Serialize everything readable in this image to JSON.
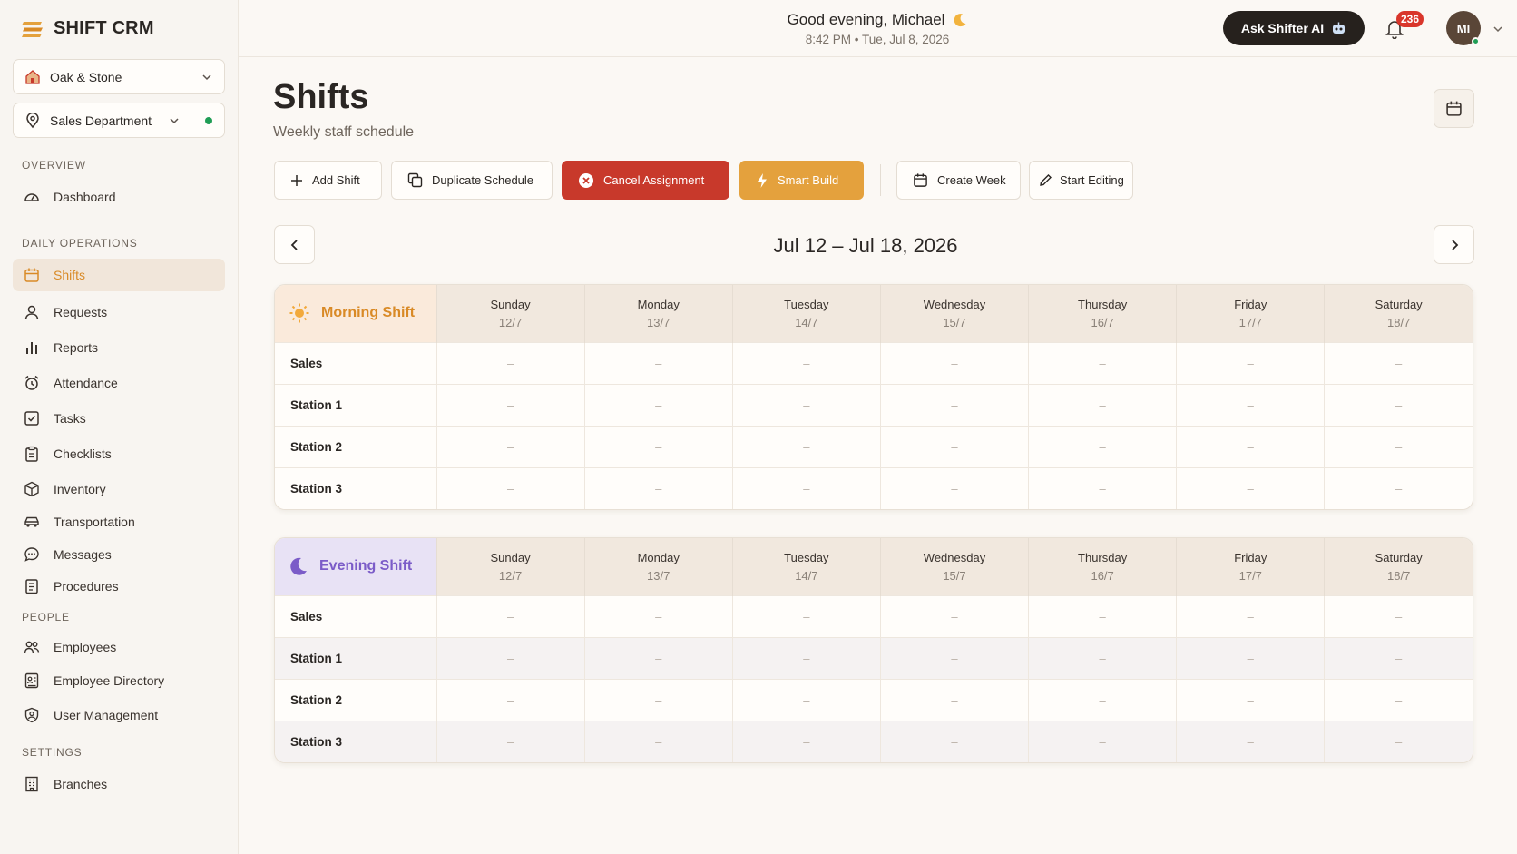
{
  "brand": {
    "name": "SHIFT CRM"
  },
  "sidebar": {
    "business_select": {
      "value": "Oak & Stone"
    },
    "department_select": {
      "value": "Sales Department"
    },
    "sections": {
      "overview": "OVERVIEW",
      "daily": "DAILY OPERATIONS",
      "people": "PEOPLE",
      "settings": "SETTINGS"
    },
    "items": [
      {
        "label": "Dashboard",
        "icon": "dashboard-icon"
      },
      {
        "label": "Shifts",
        "icon": "calendar-icon",
        "active": true
      },
      {
        "label": "Requests",
        "icon": "user-icon"
      },
      {
        "label": "Reports",
        "icon": "bar-chart-icon"
      },
      {
        "label": "Attendance",
        "icon": "alarm-clock-icon"
      },
      {
        "label": "Tasks",
        "icon": "checkbox-icon"
      },
      {
        "label": "Checklists",
        "icon": "clipboard-icon"
      },
      {
        "label": "Inventory",
        "icon": "box-icon"
      },
      {
        "label": "Transportation",
        "icon": "car-icon"
      },
      {
        "label": "Messages",
        "icon": "chat-icon"
      },
      {
        "label": "Procedures",
        "icon": "document-icon"
      },
      {
        "label": "Employees",
        "icon": "users-icon"
      },
      {
        "label": "Employee Directory",
        "icon": "directory-icon"
      },
      {
        "label": "User Management",
        "icon": "user-shield-icon"
      },
      {
        "label": "Branches",
        "icon": "building-icon"
      }
    ]
  },
  "topbar": {
    "greeting": "Good evening, Michael",
    "time": "8:42 PM",
    "date": "Tue, Jul 8, 2026",
    "ask_ai_label": "Ask Shifter AI",
    "notification_count": "236",
    "avatar_initials": "MI"
  },
  "page": {
    "title": "Shifts",
    "subtitle": "Weekly staff schedule"
  },
  "toolbar": {
    "add_shift": "Add Shift",
    "duplicate": "Duplicate Schedule",
    "cancel": "Cancel Assignment",
    "smart_build": "Smart Build",
    "create_week": "Create Week",
    "start_editing": "Start Editing"
  },
  "week": {
    "range": "Jul 12 – Jul 18, 2026"
  },
  "colors": {
    "accent": "#d98a26",
    "danger": "#c8392b",
    "warning": "#e4a13d",
    "evening": "#7b5cc8"
  },
  "days": [
    {
      "name": "Sunday",
      "date": "12/7"
    },
    {
      "name": "Monday",
      "date": "13/7"
    },
    {
      "name": "Tuesday",
      "date": "14/7"
    },
    {
      "name": "Wednesday",
      "date": "15/7"
    },
    {
      "name": "Thursday",
      "date": "16/7"
    },
    {
      "name": "Friday",
      "date": "17/7"
    },
    {
      "name": "Saturday",
      "date": "18/7"
    }
  ],
  "shifts": [
    {
      "title": "Morning Shift",
      "rows": [
        {
          "label": "Sales",
          "cells": [
            "–",
            "–",
            "–",
            "–",
            "–",
            "–",
            "–"
          ]
        },
        {
          "label": "Station 1",
          "cells": [
            "–",
            "–",
            "–",
            "–",
            "–",
            "–",
            "–"
          ]
        },
        {
          "label": "Station 2",
          "cells": [
            "–",
            "–",
            "–",
            "–",
            "–",
            "–",
            "–"
          ]
        },
        {
          "label": "Station 3",
          "cells": [
            "–",
            "–",
            "–",
            "–",
            "–",
            "–",
            "–"
          ]
        }
      ]
    },
    {
      "title": "Evening Shift",
      "rows": [
        {
          "label": "Sales",
          "cells": [
            "–",
            "–",
            "–",
            "–",
            "–",
            "–",
            "–"
          ]
        },
        {
          "label": "Station 1",
          "cells": [
            "–",
            "–",
            "–",
            "–",
            "–",
            "–",
            "–"
          ]
        },
        {
          "label": "Station 2",
          "cells": [
            "–",
            "–",
            "–",
            "–",
            "–",
            "–",
            "–"
          ]
        },
        {
          "label": "Station 3",
          "cells": [
            "–",
            "–",
            "–",
            "–",
            "–",
            "–",
            "–"
          ]
        }
      ]
    }
  ]
}
